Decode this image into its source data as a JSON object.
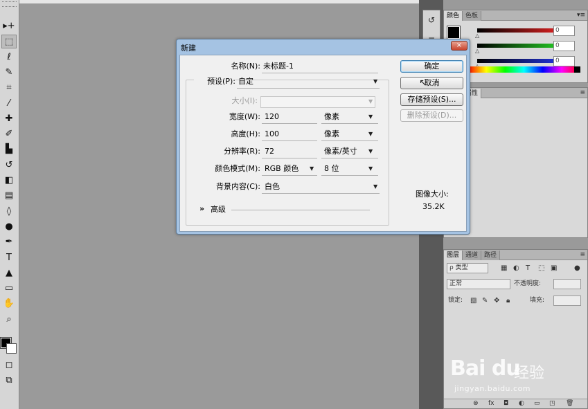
{
  "toolbox": {
    "tools": [
      {
        "name": "move-tool",
        "glyph": "▸+"
      },
      {
        "name": "marquee-tool",
        "glyph": "⬚"
      },
      {
        "name": "lasso-tool",
        "glyph": "ℓ"
      },
      {
        "name": "quick-select-tool",
        "glyph": "✎"
      },
      {
        "name": "crop-tool",
        "glyph": "⌗"
      },
      {
        "name": "eyedropper-tool",
        "glyph": "⁄"
      },
      {
        "name": "healing-brush-tool",
        "glyph": "✚"
      },
      {
        "name": "brush-tool",
        "glyph": "✐"
      },
      {
        "name": "clone-stamp-tool",
        "glyph": "▙"
      },
      {
        "name": "history-brush-tool",
        "glyph": "↺"
      },
      {
        "name": "eraser-tool",
        "glyph": "◧"
      },
      {
        "name": "gradient-tool",
        "glyph": "▤"
      },
      {
        "name": "blur-tool",
        "glyph": "◊"
      },
      {
        "name": "dodge-tool",
        "glyph": "●"
      },
      {
        "name": "pen-tool",
        "glyph": "✒"
      },
      {
        "name": "type-tool",
        "glyph": "T"
      },
      {
        "name": "path-select-tool",
        "glyph": "▲"
      },
      {
        "name": "shape-tool",
        "glyph": "▭"
      },
      {
        "name": "hand-tool",
        "glyph": "✋"
      },
      {
        "name": "zoom-tool",
        "glyph": "⌕"
      }
    ]
  },
  "dock": {
    "mini_panels": [
      {
        "name": "history-panel-icon",
        "glyph": "↺"
      },
      {
        "name": "actions-panel-icon",
        "glyph": "≡"
      }
    ]
  },
  "color_panel": {
    "tabs": [
      "颜色",
      "色板"
    ],
    "slider_colors": [
      "#cc1f1f",
      "#22bb22",
      "#1f2fcc"
    ],
    "values": [
      "0",
      "0",
      "0"
    ]
  },
  "props_panel": {
    "tabs": [
      "样式",
      "属性"
    ]
  },
  "layers_panel": {
    "tabs": [
      "图层",
      "通道",
      "路径"
    ],
    "filter_label": "ρ 类型",
    "blend_mode": "正常",
    "opacity_label": "不透明度:",
    "lock_label": "锁定:",
    "fill_label": "填充:"
  },
  "dialog": {
    "title": "新建",
    "close_glyph": "×",
    "fields": {
      "name_label": "名称(N):",
      "name_value": "未标题-1",
      "preset_label": "预设(P):",
      "preset_value": "自定",
      "size_label": "大小(I):",
      "width_label": "宽度(W):",
      "width_value": "120",
      "width_unit": "像素",
      "height_label": "高度(H):",
      "height_value": "100",
      "height_unit": "像素",
      "resolution_label": "分辨率(R):",
      "resolution_value": "72",
      "resolution_unit": "像素/英寸",
      "color_mode_label": "颜色模式(M):",
      "color_mode_value": "RGB 颜色",
      "bit_depth_value": "8 位",
      "background_label": "背景内容(C):",
      "background_value": "白色",
      "advanced_toggle": "»",
      "advanced_label": "高级"
    },
    "buttons": {
      "ok": "确定",
      "cancel": "取消",
      "save_preset": "存储预设(S)...",
      "delete_preset": "删除预设(D)..."
    },
    "image_size_title": "图像大小:",
    "image_size_value": "35.2K"
  },
  "watermark": {
    "brand": "Bai du",
    "jingyan": "经验",
    "url": "jingyan.baidu.com"
  }
}
